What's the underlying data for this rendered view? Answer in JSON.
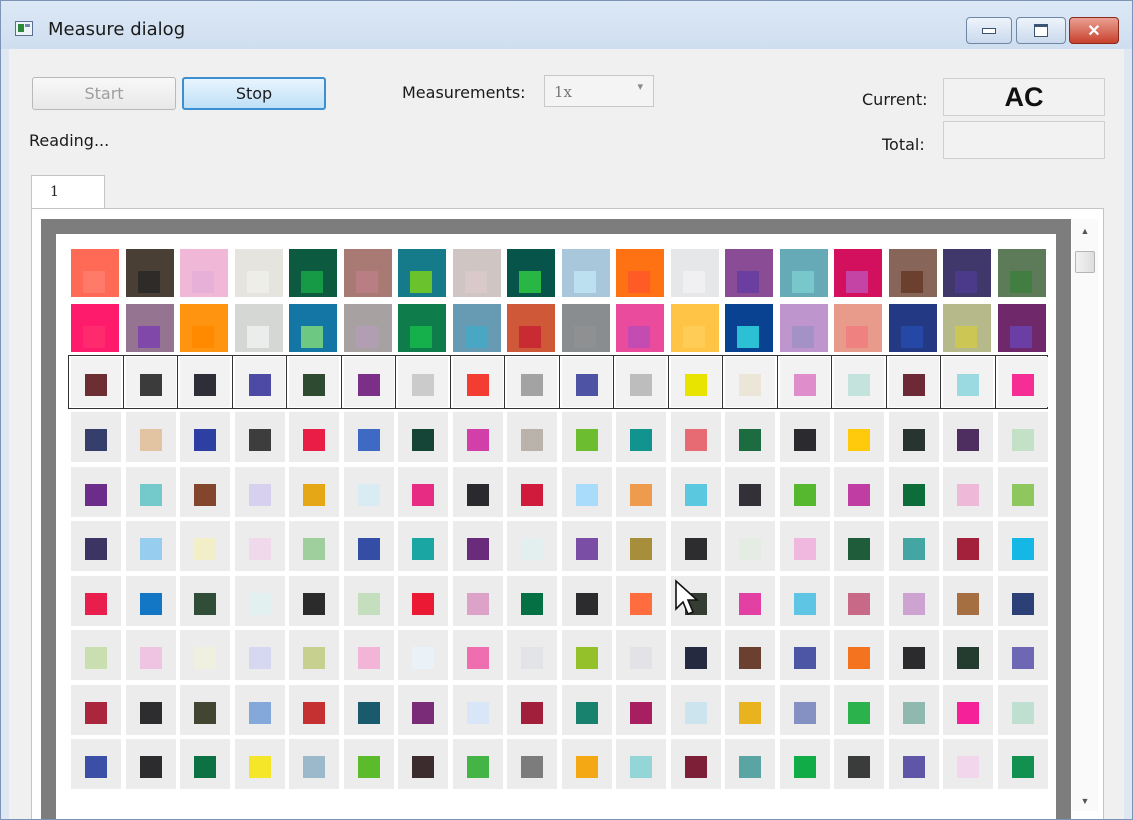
{
  "window": {
    "title": "Measure dialog"
  },
  "toolbar": {
    "start_label": "Start",
    "stop_label": "Stop",
    "measurements_label": "Measurements:",
    "measurements_value": "1x",
    "status_text": "Reading..."
  },
  "readout": {
    "current_label": "Current:",
    "current_value": "AC",
    "total_label": "Total:",
    "total_value": ""
  },
  "tabs": [
    {
      "label": "1"
    }
  ],
  "patch_rows": [
    {
      "row": "A",
      "outer": [
        "#ff6a56",
        "#4a3f35",
        "#f0b8d6",
        "#e5e4df",
        "#0c5a3f",
        "#a97a74",
        "#157b8b",
        "#cfc5c2",
        "#07554a",
        "#a8c7da",
        "#ff7213",
        "#e6e7e8",
        "#8a4d95",
        "#67aab7",
        "#d3105e",
        "#876559",
        "#40386a",
        "#5e7b59"
      ],
      "inner": [
        "#ff7a68",
        "#2e2b29",
        "#e6b0d8",
        "#eeeee8",
        "#169a45",
        "#b87e83",
        "#6ac32c",
        "#dac9cb",
        "#28b645",
        "#bde0f0",
        "#ff5b27",
        "#f0f0f2",
        "#6b3fa0",
        "#78c8cb",
        "#c444a5",
        "#6c402f",
        "#4b3a8a",
        "#427d42"
      ]
    },
    {
      "row": "B",
      "outer": [
        "#ff1b6c",
        "#947490",
        "#ff9410",
        "#d5d7d5",
        "#1376a5",
        "#a8a1a2",
        "#0e7c4b",
        "#679bb3",
        "#cf5838",
        "#8a8d90",
        "#ea4b9c",
        "#ffc446",
        "#0a4292",
        "#be95cc",
        "#e89b8a",
        "#243983",
        "#b6b989",
        "#6f296b"
      ],
      "inner": [
        "#ff2a6e",
        "#8048a9",
        "#ff8a00",
        "#ebedec",
        "#6dc882",
        "#b19eb2",
        "#15b04b",
        "#4aa7c3",
        "#c92b33",
        "#8e9091",
        "#c44bb1",
        "#ffcc55",
        "#2bc0d3",
        "#a491c5",
        "#ef8180",
        "#2548a6",
        "#ccc655",
        "#6a3ea5"
      ]
    }
  ],
  "frame_row": [
    "#6c2e32",
    "#3b3b3b",
    "#2e2e38",
    "#4c4aa5",
    "#2e4a30",
    "#7b2f88",
    "#cbcbcb",
    "#f43d32",
    "#a3a3a3",
    "#4e53a4",
    "#bdbdbd",
    "#e9e300",
    "#ece6d8",
    "#e08dcc",
    "#c3e3dc",
    "#6d2a36",
    "#9bdae0",
    "#f52d94"
  ],
  "grid_rows": [
    [
      "#363e6b",
      "#e2c3a2",
      "#2e3fa4",
      "#3d3d3d",
      "#e91d45",
      "#3f6ac4",
      "#154537",
      "#d23fa8",
      "#b9b3ac",
      "#6cbd2f",
      "#13938f",
      "#e76b73",
      "#1d6c41",
      "#2b2b2f",
      "#ffca0c",
      "#273430",
      "#4e2d61",
      "#c3e1c7"
    ],
    [
      "#6c2d8a",
      "#74c9cb",
      "#83462d",
      "#d7d0ef",
      "#e6a716",
      "#d9ebf3",
      "#e72d83",
      "#2a2a2e",
      "#d01b3c",
      "#a8dcfa",
      "#ee9b4e",
      "#5ac9df",
      "#343037",
      "#55b82f",
      "#c03ea4",
      "#0c6d3b",
      "#eeb8d8",
      "#8ec75e"
    ],
    [
      "#3c3564",
      "#97cdee",
      "#f2efc8",
      "#f1d9ec",
      "#9fcf9c",
      "#344da5",
      "#1aa6a3",
      "#6a2c7a",
      "#e3efee",
      "#7b4ea5",
      "#a78e3a",
      "#2d2d2f",
      "#e5ece4",
      "#f0b8de",
      "#1f5c3a",
      "#44a6a3",
      "#a3213a",
      "#15b7e4"
    ],
    [
      "#ea1e4d",
      "#1377c5",
      "#2f4d37",
      "#e2f0ef",
      "#2b2b2c",
      "#c5dfbe",
      "#ec1935",
      "#dca2c8",
      "#057044",
      "#2c2c2e",
      "#ff6d3f",
      "#353d33",
      "#e240a3",
      "#5ec5e4",
      "#c76987",
      "#cda3d1",
      "#a56f41",
      "#2d3f77"
    ],
    [
      "#cadfb0",
      "#efc3e2",
      "#eff0e0",
      "#d6d8f1",
      "#c7d08f",
      "#f2b5d7",
      "#eaf2f7",
      "#ee6eaf",
      "#e3e4e7",
      "#94c12a",
      "#e2e2e7",
      "#262a40",
      "#6c4030",
      "#4d56a5",
      "#f4731e",
      "#2b2b2e",
      "#243b30",
      "#6e68b4"
    ],
    [
      "#a9263c",
      "#2d2d2f",
      "#424531",
      "#83a8d9",
      "#c53130",
      "#195a6d",
      "#7b2c79",
      "#d8e6f7",
      "#a21f3c",
      "#19826e",
      "#a81f61",
      "#cce4ee",
      "#e9b21f",
      "#8591c2",
      "#2cb24d",
      "#8fb9ae",
      "#f42198",
      "#bfe0d0"
    ],
    [
      "#3b4fa7",
      "#2c2c2e",
      "#0c7143",
      "#f5e629",
      "#9bb9ca",
      "#5cbb2a",
      "#3d2c2d",
      "#44b447",
      "#7d7c7c",
      "#f4a814",
      "#94d5d7",
      "#7d1f36",
      "#5aa4a4",
      "#10ac47",
      "#3a3b3b",
      "#5f56a8",
      "#f2d7ec",
      "#129050"
    ]
  ]
}
